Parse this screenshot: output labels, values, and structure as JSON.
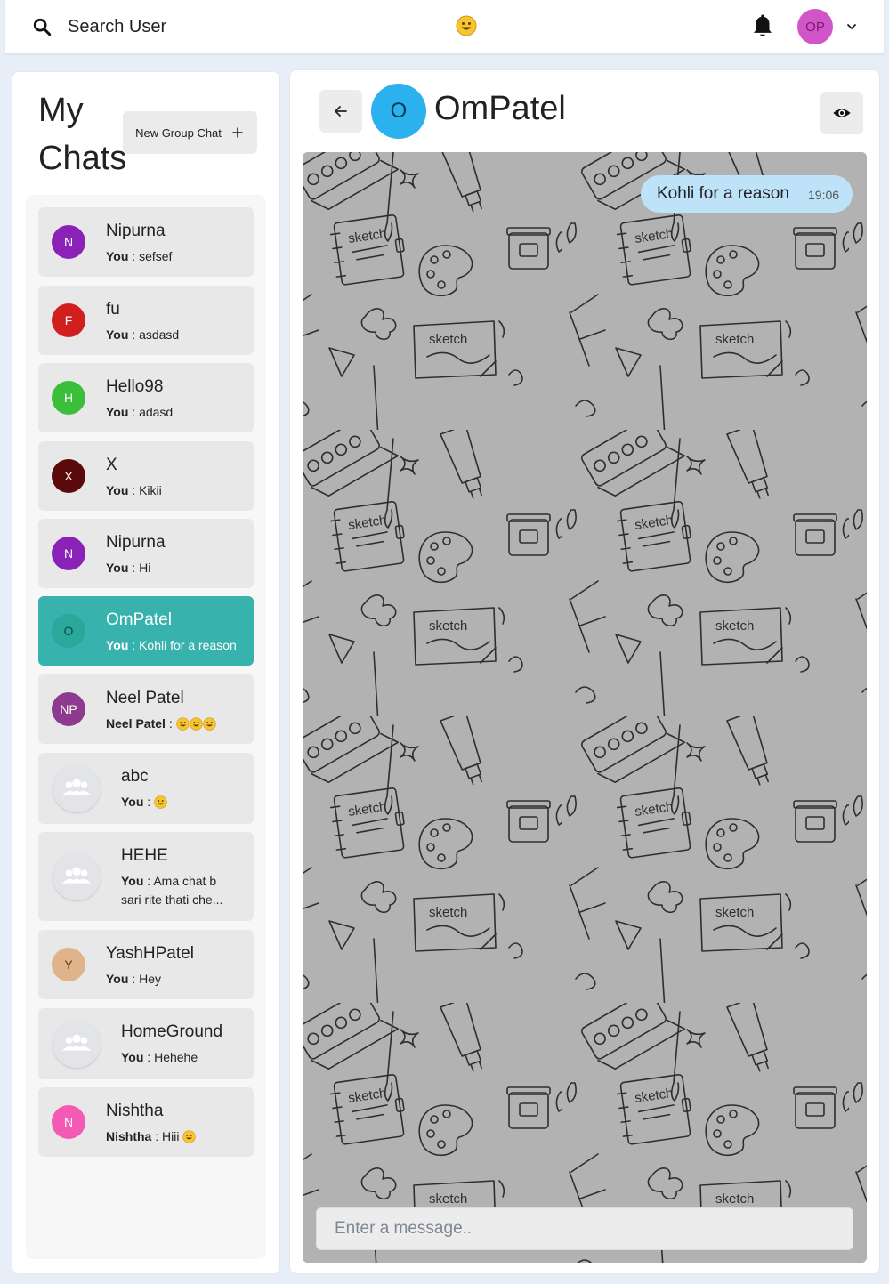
{
  "topbar": {
    "search_label": "Search User",
    "center_icon": "smile-emoji",
    "notification_icon": "bell-icon",
    "profile_initials": "OP",
    "profile_color": "#cf55c9"
  },
  "sidebar": {
    "title_line1": "My",
    "title_line2": "Chats",
    "new_group_label": "New Group Chat",
    "chats": [
      {
        "initials": "N",
        "name": "Nipurna",
        "sender": "You",
        "message": "sefsef",
        "color": "#8a22b8"
      },
      {
        "initials": "F",
        "name": "fu",
        "sender": "You",
        "message": "asdasd",
        "color": "#d11f1f"
      },
      {
        "initials": "H",
        "name": "Hello98",
        "sender": "You",
        "message": "adasd",
        "color": "#3bbf3b"
      },
      {
        "initials": "X",
        "name": "X",
        "sender": "You",
        "message": "Kikii",
        "color": "#5a0a0a"
      },
      {
        "initials": "N",
        "name": "Nipurna",
        "sender": "You",
        "message": "Hi",
        "color": "#8a22b8"
      },
      {
        "initials": "O",
        "name": "OmPatel",
        "sender": "You",
        "message": "Kohli for a reason",
        "color": "#2aa89c",
        "active": true
      },
      {
        "initials": "NP",
        "name": "Neel Patel",
        "sender": "Neel Patel",
        "message": "",
        "emojis": 3,
        "color": "#8e3a8e"
      },
      {
        "initials": "",
        "name": "abc",
        "sender": "You",
        "message": "",
        "emojis": 1,
        "group": true
      },
      {
        "initials": "",
        "name": "HEHE",
        "sender": "You",
        "message": "Ama chat b",
        "message_line2": "sari rite thati che...",
        "group": true
      },
      {
        "initials": "Y",
        "name": "YashHPatel",
        "sender": "You",
        "message": "Hey",
        "color": "#e0b48a"
      },
      {
        "initials": "",
        "name": "HomeGround",
        "sender": "You",
        "message": "Hehehe",
        "group": true
      },
      {
        "initials": "N",
        "name": "Nishtha",
        "sender": "Nishtha",
        "message": "Hiii",
        "emojis": 1,
        "color": "#f25ab5"
      }
    ]
  },
  "conversation": {
    "header_initial": "O",
    "header_name": "OmPatel",
    "header_color": "#2bb1ee",
    "messages": [
      {
        "text": "Kohli for a reason",
        "time": "19:06"
      }
    ],
    "input_placeholder": "Enter a message.."
  }
}
